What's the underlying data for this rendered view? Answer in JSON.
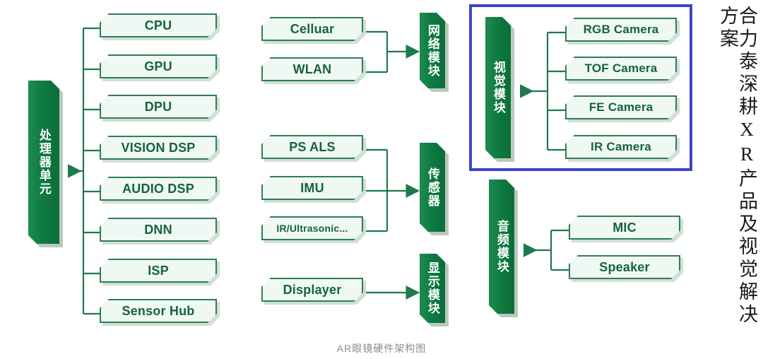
{
  "figure": {
    "caption": "AR眼镜硬件架构图",
    "side_title": "合力泰深耕XR产品及视觉解决方案",
    "colors": {
      "module_green": "#0e7b41",
      "node_fill": "#eff8f2",
      "node_border": "#2f7d54",
      "node_text": "#17633c",
      "highlight_blue": "#3b45c9",
      "caption_gray": "#8c8c8c",
      "background": "#ffffff"
    }
  },
  "modules": {
    "processor": {
      "label": "处理器单元"
    },
    "network": {
      "label": "网络模块"
    },
    "sensor": {
      "label": "传感器"
    },
    "display": {
      "label": "显示模块"
    },
    "vision": {
      "label": "视觉模块"
    },
    "audio": {
      "label": "音频模块"
    }
  },
  "processor_nodes": [
    {
      "label": "CPU"
    },
    {
      "label": "GPU"
    },
    {
      "label": "DPU"
    },
    {
      "label": "VISION DSP"
    },
    {
      "label": "AUDIO DSP"
    },
    {
      "label": "DNN"
    },
    {
      "label": "ISP"
    },
    {
      "label": "Sensor Hub"
    }
  ],
  "network_nodes": [
    {
      "label": "Celluar"
    },
    {
      "label": "WLAN"
    }
  ],
  "sensor_nodes": [
    {
      "label": "PS ALS"
    },
    {
      "label": "IMU"
    },
    {
      "label": "IR/Ultrasonic..."
    }
  ],
  "display_nodes": [
    {
      "label": "Displayer"
    }
  ],
  "vision_nodes": [
    {
      "label": "RGB Camera"
    },
    {
      "label": "TOF Camera"
    },
    {
      "label": "FE Camera"
    },
    {
      "label": "IR Camera"
    }
  ],
  "audio_nodes": [
    {
      "label": "MIC"
    },
    {
      "label": "Speaker"
    }
  ]
}
